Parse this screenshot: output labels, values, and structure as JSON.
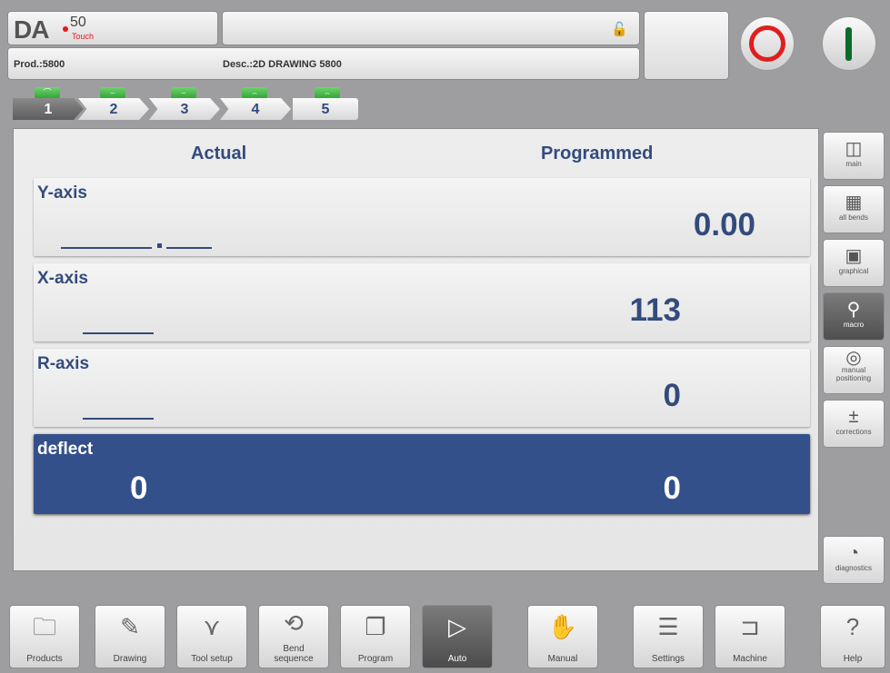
{
  "header": {
    "logo_text": "DA",
    "logo_model": "50",
    "logo_sub": "Touch",
    "product_label": "Prod.:5800",
    "desc_label": "Desc.:2D DRAWING 5800"
  },
  "steps": [
    {
      "num": "1",
      "badge": "⌒"
    },
    {
      "num": "2",
      "badge": "⌣"
    },
    {
      "num": "3",
      "badge": "⌣"
    },
    {
      "num": "4",
      "badge": "⌢"
    },
    {
      "num": "5",
      "badge": "⌢"
    }
  ],
  "main": {
    "actual_header": "Actual",
    "programmed_header": "Programmed",
    "y_axis": {
      "label": "Y-axis",
      "programmed": "0.00"
    },
    "x_axis": {
      "label": "X-axis",
      "programmed": "113"
    },
    "r_axis": {
      "label": "R-axis",
      "programmed": "0"
    },
    "deflect": {
      "label": "deflect",
      "actual": "0",
      "programmed": "0"
    }
  },
  "side": {
    "main": "main",
    "all_bends": "all bends",
    "graphical": "graphical",
    "macro": "macro",
    "manual_positioning_1": "manual",
    "manual_positioning_2": "positioning",
    "corrections": "corrections",
    "diagnostics": "diagnostics"
  },
  "bottom": {
    "products": "Products",
    "drawing": "Drawing",
    "tool_setup": "Tool setup",
    "bend_sequence_1": "Bend",
    "bend_sequence_2": "sequence",
    "program": "Program",
    "auto": "Auto",
    "manual": "Manual",
    "settings": "Settings",
    "machine": "Machine",
    "help": "Help"
  },
  "colors": {
    "accent": "#334b7c",
    "highlight_row": "#34508a",
    "stop": "#e01f1f",
    "start": "#0d6b2a"
  }
}
